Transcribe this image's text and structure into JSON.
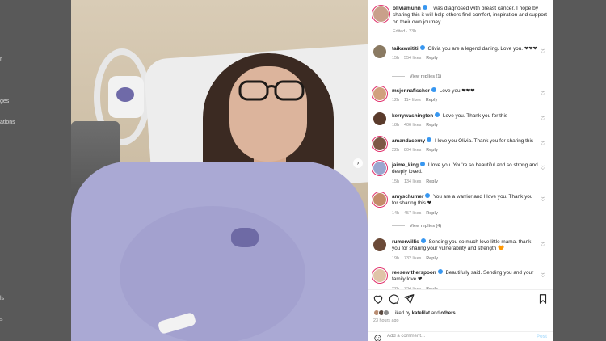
{
  "left_nav": {
    "frag_1": "r",
    "frag_2": "ges",
    "frag_3": "ations",
    "frag_4": "ls",
    "frag_5": "s"
  },
  "post": {
    "author": "oliviamunn",
    "caption": "I was diagnosed with breast cancer. I hope by sharing this it will help others find comfort, inspiration and support on their own journey.",
    "edited": "Edited · 23h"
  },
  "comments": [
    {
      "user": "taikawaititi",
      "text": "Olivia you are a legend darling. Love you. ❤❤❤",
      "age": "15h",
      "likes": "554 likes",
      "reply": "Reply",
      "view_replies": "View replies (1)"
    },
    {
      "user": "msjennafischer",
      "text": "Love you ❤❤❤",
      "age": "12h",
      "likes": "114 likes",
      "reply": "Reply"
    },
    {
      "user": "kerrywashington",
      "text": "Love you. Thank you for this",
      "age": "18h",
      "likes": "406 likes",
      "reply": "Reply"
    },
    {
      "user": "amandacerny",
      "text": "I love you Olivia. Thank you for sharing this",
      "age": "22h",
      "likes": "804 likes",
      "reply": "Reply"
    },
    {
      "user": "jaime_king",
      "text": "I love you. You're so beautiful and so strong and deeply loved.",
      "age": "15h",
      "likes": "134 likes",
      "reply": "Reply"
    },
    {
      "user": "amyschumer",
      "text": "You are a warrior and I love you. Thank you for sharing this ❤",
      "age": "14h",
      "likes": "457 likes",
      "reply": "Reply",
      "view_replies": "View replies (4)"
    },
    {
      "user": "rumerwillis",
      "text": "Sending you so much love little mama. thank you for sharing your vulnerability and strength 🧡",
      "age": "19h",
      "likes": "732 likes",
      "reply": "Reply"
    },
    {
      "user": "reesewitherspoon",
      "text": "Beautifully said. Sending you and your family love ❤",
      "age": "22h",
      "likes": "734 likes",
      "reply": "Reply"
    }
  ],
  "actions": {
    "liked_prefix": "Liked by",
    "liked_user": "katelilat",
    "liked_and": "and",
    "liked_others": "others",
    "time_ago": "23 hours ago",
    "add_comment_placeholder": "Add a comment...",
    "post_label": "Post"
  },
  "colors": {
    "verified": "#3897f0",
    "heart": "#ed4956",
    "post_disabled": "#b2dffc"
  },
  "icons": [
    "heart-icon",
    "comment-icon",
    "share-icon",
    "bookmark-icon",
    "emoji-icon",
    "verified-badge-icon",
    "carousel-next-icon"
  ]
}
